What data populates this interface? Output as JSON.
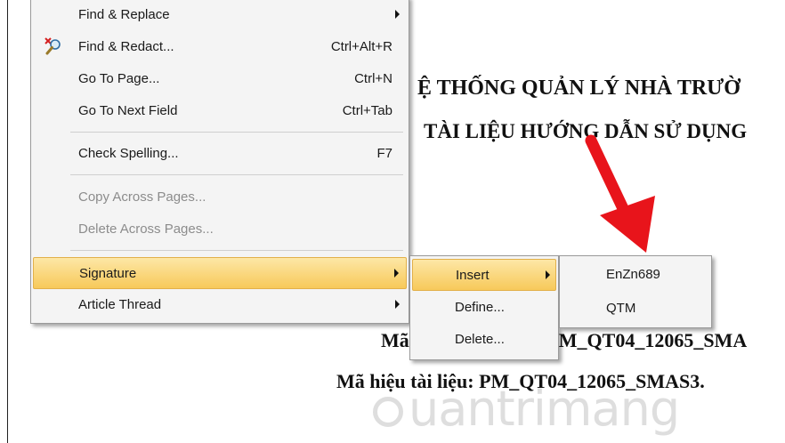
{
  "document": {
    "title_line1": "Ệ THỐNG QUẢN LÝ NHÀ TRƯỜ",
    "title_line2": "TÀI LIỆU HƯỚNG DẪN SỬ DỤNG",
    "code_line1": "Mã",
    "code_line1_rest": "M_QT04_12065_SMA",
    "code_line2": "Mã hiệu tài liệu: PM_QT04_12065_SMAS3.",
    "watermark": "uantrimang"
  },
  "menu": {
    "items": [
      {
        "label": "Find & Replace",
        "shortcut": "",
        "submenu": true,
        "enabled": true
      },
      {
        "label": "Find & Redact...",
        "shortcut": "Ctrl+Alt+R",
        "submenu": false,
        "enabled": true,
        "icon": "find-redact-icon"
      },
      {
        "label": "Go To Page...",
        "shortcut": "Ctrl+N",
        "submenu": false,
        "enabled": true
      },
      {
        "label": "Go To Next Field",
        "shortcut": "Ctrl+Tab",
        "submenu": false,
        "enabled": true
      },
      {
        "label": "Check Spelling...",
        "shortcut": "F7",
        "submenu": false,
        "enabled": true
      },
      {
        "label": "Copy Across Pages...",
        "shortcut": "",
        "submenu": false,
        "enabled": false
      },
      {
        "label": "Delete Across Pages...",
        "shortcut": "",
        "submenu": false,
        "enabled": false
      },
      {
        "label": "Signature",
        "shortcut": "",
        "submenu": true,
        "enabled": true,
        "highlighted": true
      },
      {
        "label": "Article Thread",
        "shortcut": "",
        "submenu": true,
        "enabled": true
      }
    ]
  },
  "signature_submenu": {
    "items": [
      {
        "label": "Insert",
        "submenu": true,
        "highlighted": true
      },
      {
        "label": "Define..."
      },
      {
        "label": "Delete..."
      }
    ]
  },
  "insert_submenu": {
    "items": [
      {
        "label": "EnZn689"
      },
      {
        "label": "QTM"
      }
    ]
  },
  "colors": {
    "highlight": "#f7c95a",
    "arrow": "#e8141b",
    "menu_bg": "#f4f4f4"
  }
}
